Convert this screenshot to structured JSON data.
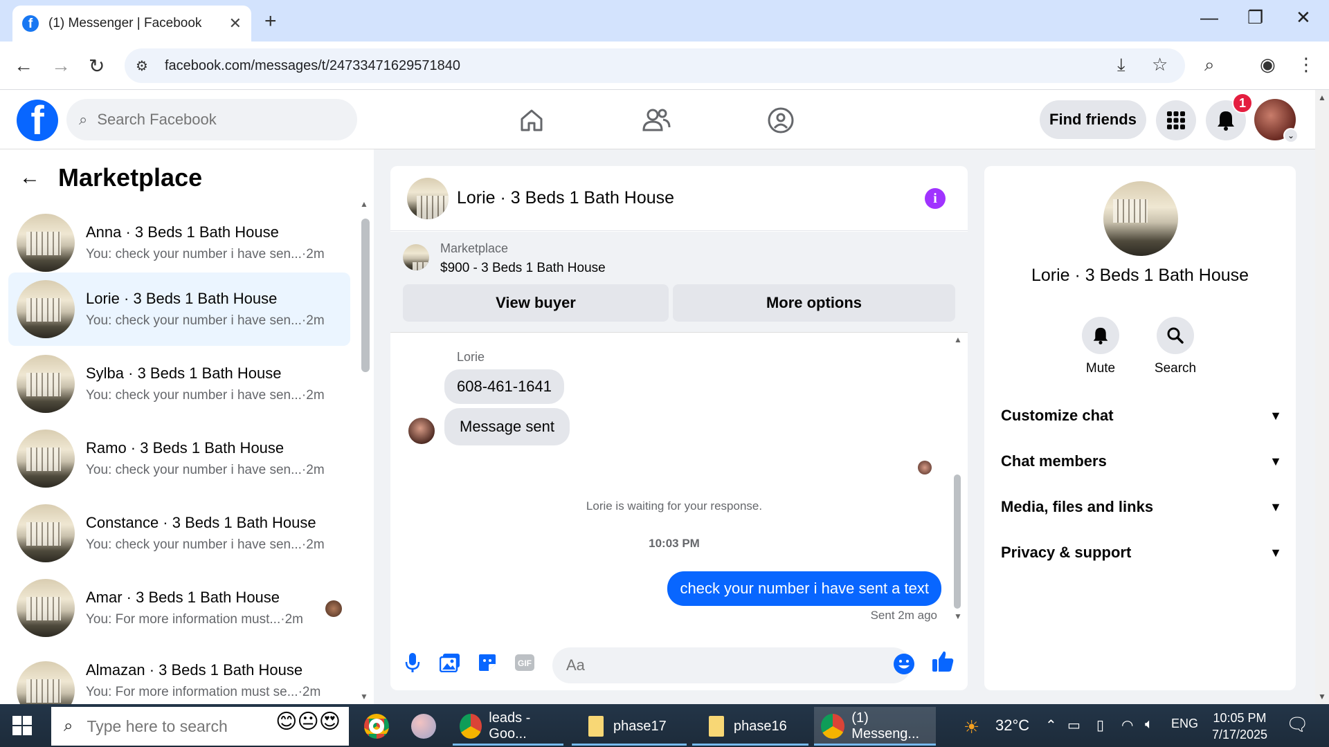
{
  "browser": {
    "tab_title": "(1) Messenger | Facebook",
    "url": "facebook.com/messages/t/24733471629571840",
    "tab_close": "✕",
    "new_tab": "+"
  },
  "fb": {
    "logo": "f",
    "search_placeholder": "Search Facebook",
    "find_friends": "Find friends",
    "notification_count": "1"
  },
  "sidebar": {
    "title": "Marketplace",
    "chats": [
      {
        "name": "Anna · 3 Beds 1 Bath House",
        "preview": "You: check your number i have sen...·2m"
      },
      {
        "name": "Lorie · 3 Beds 1 Bath House",
        "preview": "You: check your number i have sen...·2m"
      },
      {
        "name": "Sylba · 3 Beds 1 Bath House",
        "preview": "You: check your number i have sen...·2m"
      },
      {
        "name": "Ramo · 3 Beds 1 Bath House",
        "preview": "You: check your number i have sen...·2m"
      },
      {
        "name": "Constance · 3 Beds 1 Bath House",
        "preview": "You: check your number i have sen...·2m"
      },
      {
        "name": "Amar · 3 Beds 1 Bath House",
        "preview": "You: For more information must...·2m"
      },
      {
        "name": "Almazan · 3 Beds 1 Bath House",
        "preview": "You: For more information must se...·2m"
      }
    ]
  },
  "conversation": {
    "title": "Lorie · 3 Beds 1 Bath House",
    "listing_label": "Marketplace",
    "listing_title": "$900 - 3 Beds 1 Bath House",
    "view_buyer": "View buyer",
    "more_options": "More options",
    "sender_name": "Lorie",
    "incoming": [
      "608-461-1641",
      "Message sent"
    ],
    "waiting_text": "Lorie is waiting for your response.",
    "timestamp": "10:03 PM",
    "outgoing": "check your number i have sent a text",
    "sent_status": "Sent 2m ago",
    "composer_placeholder": "Aa"
  },
  "details": {
    "name": "Lorie · 3 Beds 1 Bath House",
    "actions": [
      "Mute",
      "Search"
    ],
    "sections": [
      "Customize chat",
      "Chat members",
      "Media, files and links",
      "Privacy & support"
    ]
  },
  "taskbar": {
    "search_placeholder": "Type here to search",
    "apps": [
      "leads - Goo...",
      "phase17",
      "phase16",
      "(1) Messeng..."
    ],
    "weather": "32°C",
    "language": "ENG",
    "time": "10:05 PM",
    "date": "7/17/2025"
  },
  "colors": {
    "fb_blue": "#0866ff",
    "active_chat_bg": "#ebf5ff",
    "info_purple": "#a033ff",
    "badge_red": "#e41e3f"
  }
}
